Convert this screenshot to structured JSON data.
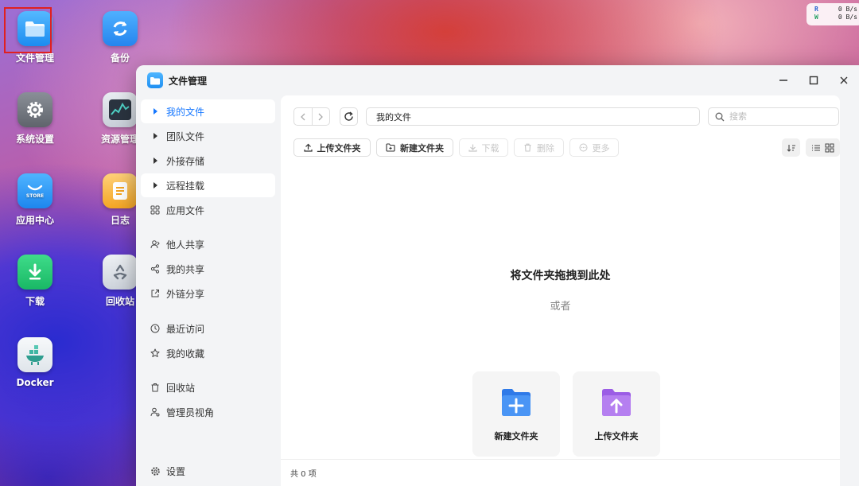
{
  "desktop": {
    "icons": [
      {
        "label": "文件管理",
        "icon": "folder-icon"
      },
      {
        "label": "备份",
        "icon": "backup-sync-icon"
      },
      {
        "label": "系统设置",
        "icon": "gear-icon"
      },
      {
        "label": "资源管理",
        "icon": "resource-monitor-icon"
      },
      {
        "label": "应用中心",
        "icon": "store-icon"
      },
      {
        "label": "日志",
        "icon": "log-icon"
      },
      {
        "label": "下载",
        "icon": "download-icon"
      },
      {
        "label": "回收站",
        "icon": "recycle-bin-icon"
      },
      {
        "label": "Docker",
        "icon": "docker-icon"
      }
    ],
    "io_widget": {
      "read_label": "R",
      "read_value": "0 B/s",
      "write_label": "W",
      "write_value": "0 B/s"
    }
  },
  "window": {
    "title": "文件管理",
    "sidebar": {
      "items": [
        {
          "label": "我的文件",
          "icon": "caret-right-icon"
        },
        {
          "label": "团队文件",
          "icon": "caret-right-icon"
        },
        {
          "label": "外接存储",
          "icon": "caret-right-icon"
        },
        {
          "label": "远程挂载",
          "icon": "caret-right-icon"
        },
        {
          "label": "应用文件",
          "icon": "apps-grid-icon"
        },
        {
          "label": "他人共享",
          "icon": "user-share-icon"
        },
        {
          "label": "我的共享",
          "icon": "share-icon"
        },
        {
          "label": "外链分享",
          "icon": "external-link-icon"
        },
        {
          "label": "最近访问",
          "icon": "clock-icon"
        },
        {
          "label": "我的收藏",
          "icon": "star-icon"
        },
        {
          "label": "回收站",
          "icon": "trash-icon"
        },
        {
          "label": "管理员视角",
          "icon": "admin-icon"
        }
      ],
      "settings_label": "设置"
    },
    "path": "我的文件",
    "search_placeholder": "搜索",
    "toolbar": {
      "upload_folder": "上传文件夹",
      "new_folder": "新建文件夹",
      "download": "下载",
      "delete": "删除",
      "more": "更多"
    },
    "empty_state": {
      "title": "将文件夹拖拽到此处",
      "or": "或者",
      "new_folder_card": "新建文件夹",
      "upload_folder_card": "上传文件夹"
    },
    "status": "共 0 项"
  },
  "colors": {
    "accent": "#1677ff",
    "selection_box": "#e02020"
  }
}
